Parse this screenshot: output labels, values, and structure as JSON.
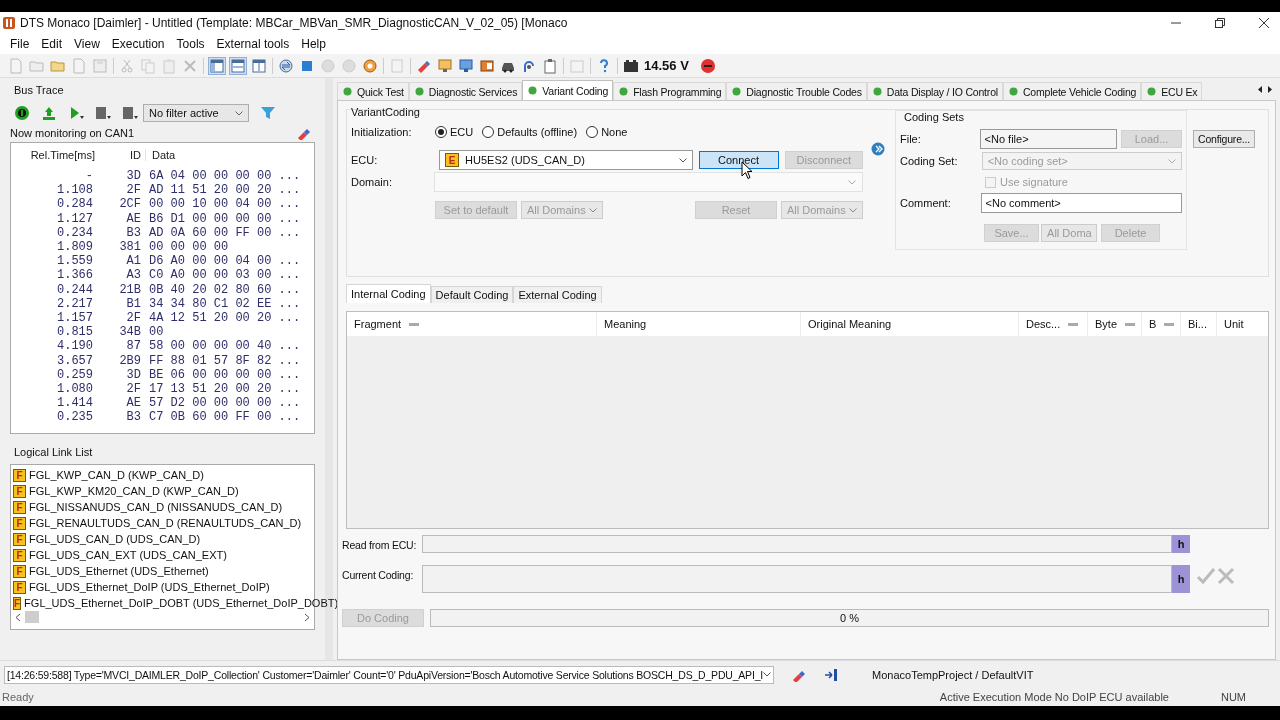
{
  "window": {
    "title": "DTS Monaco [Daimler] - Untitled (Template: MBCar_MBVan_SMR_DiagnosticCAN_V_02_05) [Monaco"
  },
  "menu": [
    "File",
    "Edit",
    "View",
    "Execution",
    "Tools",
    "External tools",
    "Help"
  ],
  "toolbar": {
    "voltage": "14.56 V"
  },
  "bus_trace": {
    "title": "Bus Trace",
    "filter": "No filter active",
    "monitoring": "Now monitoring on CAN1",
    "columns": [
      "Rel.Time[ms]",
      "ID",
      "Data"
    ],
    "rows": [
      {
        "time": "-",
        "id": "3D",
        "data": "6A 04 00 00 00 00 ..."
      },
      {
        "time": "1.108",
        "id": "2F",
        "data": "AD 11 51 20 00 20 ..."
      },
      {
        "time": "0.284",
        "id": "2CF",
        "data": "00 00 10 00 04 00 ..."
      },
      {
        "time": "1.127",
        "id": "AE",
        "data": "B6 D1 00 00 00 00 ..."
      },
      {
        "time": "0.234",
        "id": "B3",
        "data": "AD 0A 60 00 FF 00 ..."
      },
      {
        "time": "1.809",
        "id": "381",
        "data": "00 00 00 00"
      },
      {
        "time": "1.559",
        "id": "A1",
        "data": "D6 A0 00 00 04 00 ..."
      },
      {
        "time": "1.366",
        "id": "A3",
        "data": "C0 A0 00 00 03 00 ..."
      },
      {
        "time": "0.244",
        "id": "21B",
        "data": "0B 40 20 02 80 60 ..."
      },
      {
        "time": "2.217",
        "id": "B1",
        "data": "34 34 80 C1 02 EE ..."
      },
      {
        "time": "1.157",
        "id": "2F",
        "data": "4A 12 51 20 00 20 ..."
      },
      {
        "time": "0.815",
        "id": "34B",
        "data": "00"
      },
      {
        "time": "4.190",
        "id": "87",
        "data": "58 00 00 00 00 40 ..."
      },
      {
        "time": "3.657",
        "id": "2B9",
        "data": "FF 88 01 57 8F 82 ..."
      },
      {
        "time": "0.259",
        "id": "3D",
        "data": "BE 06 00 00 00 00 ..."
      },
      {
        "time": "1.080",
        "id": "2F",
        "data": "17 13 51 20 00 20 ..."
      },
      {
        "time": "1.414",
        "id": "AE",
        "data": "57 D2 00 00 00 00 ..."
      },
      {
        "time": "0.235",
        "id": "B3",
        "data": "C7 0B 60 00 FF 00 ..."
      }
    ]
  },
  "logical_link_list": {
    "title": "Logical Link List",
    "items": [
      {
        "badge": "F",
        "label": "FGL_KWP_CAN_D (KWP_CAN_D)"
      },
      {
        "badge": "F",
        "label": "FGL_KWP_KM20_CAN_D (KWP_CAN_D)"
      },
      {
        "badge": "F",
        "label": "FGL_NISSANUDS_CAN_D (NISSANUDS_CAN_D)"
      },
      {
        "badge": "F",
        "label": "FGL_RENAULTUDS_CAN_D (RENAULTUDS_CAN_D)"
      },
      {
        "badge": "F",
        "label": "FGL_UDS_CAN_D (UDS_CAN_D)"
      },
      {
        "badge": "F",
        "label": "FGL_UDS_CAN_EXT (UDS_CAN_EXT)"
      },
      {
        "badge": "F",
        "label": "FGL_UDS_Ethernet (UDS_Ethernet)"
      },
      {
        "badge": "F",
        "label": "FGL_UDS_Ethernet_DoIP (UDS_Ethernet_DoIP)"
      },
      {
        "badge": "F",
        "label": "FGL_UDS_Ethernet_DoIP_DOBT (UDS_Ethernet_DoIP_DOBT)"
      }
    ]
  },
  "tabs": [
    {
      "label": "Quick Test",
      "selected": false
    },
    {
      "label": "Diagnostic Services",
      "selected": false
    },
    {
      "label": "Variant Coding",
      "selected": true
    },
    {
      "label": "Flash Programming",
      "selected": false
    },
    {
      "label": "Diagnostic Trouble Codes",
      "selected": false
    },
    {
      "label": "Data Display / IO Control",
      "selected": false
    },
    {
      "label": "Complete Vehicle Coding",
      "selected": false
    },
    {
      "label": "ECU Ex",
      "selected": false
    }
  ],
  "variant_coding": {
    "title": "VariantCoding",
    "initialization_label": "Initialization:",
    "initialization": [
      {
        "label": "ECU",
        "selected": true
      },
      {
        "label": "Defaults (offline)",
        "selected": false
      },
      {
        "label": "None",
        "selected": false
      }
    ],
    "ecu_label": "ECU:",
    "ecu": {
      "badge": "E",
      "value": "HU5ES2 (UDS_CAN_D)"
    },
    "connect": {
      "label": "Connect",
      "disabled": false
    },
    "disconnect": {
      "label": "Disconnect",
      "disabled": true
    },
    "domain_label": "Domain:",
    "set_to_default": {
      "label": "Set to default",
      "disabled": true
    },
    "domains_left": {
      "label": "All Domains",
      "disabled": true
    },
    "reset": {
      "label": "Reset",
      "disabled": true
    },
    "domains_right": {
      "label": "All Domains",
      "disabled": true
    }
  },
  "coding_sets": {
    "title": "Coding Sets",
    "file_label": "File:",
    "file": "<No file>",
    "load": {
      "label": "Load...",
      "disabled": true
    },
    "coding_set_label": "Coding Set:",
    "coding_set": "<No coding set>",
    "use_signature": {
      "label": "Use signature",
      "checked": false
    },
    "comment_label": "Comment:",
    "comment": "<No comment>",
    "save": {
      "label": "Save...",
      "disabled": true
    },
    "domains": {
      "label": "All Doma",
      "disabled": true
    },
    "delete": {
      "label": "Delete",
      "disabled": true
    }
  },
  "configure": {
    "label": "Configure...",
    "disabled": false
  },
  "coding_tabs": [
    {
      "label": "Internal Coding",
      "selected": true
    },
    {
      "label": "Default Coding",
      "selected": false
    },
    {
      "label": "External Coding",
      "selected": false
    }
  ],
  "coding_table": {
    "columns": [
      {
        "label": "Fragment",
        "marker": true
      },
      {
        "label": "Meaning",
        "marker": false
      },
      {
        "label": "Original Meaning",
        "marker": false
      },
      {
        "label": "Desc...",
        "marker": true
      },
      {
        "label": "Byte",
        "marker": true
      },
      {
        "label": "B",
        "marker": true
      },
      {
        "label": "Bi...",
        "marker": false
      },
      {
        "label": "Unit",
        "marker": false
      }
    ]
  },
  "read_from_ecu": {
    "label": "Read from ECU:",
    "unit": "h"
  },
  "current_coding": {
    "label": "Current Coding:",
    "unit": "h"
  },
  "do_coding": {
    "label": "Do Coding",
    "disabled": true
  },
  "progress": {
    "level": 0,
    "text": "0 %"
  },
  "log_line": "[14:26:59:588] Type='MVCI_DAIMLER_DoIP_Collection' Customer='Daimler' Count='0' PduApiVersion='Bosch Automotive Service Solutions BOSCH_DS_D_PDU_API_I",
  "project": "MonacoTempProject / DefaultVIT",
  "status_bar": [
    "Ready",
    "Active Execution Mode  No DoIP ECU available",
    "NUM"
  ]
}
